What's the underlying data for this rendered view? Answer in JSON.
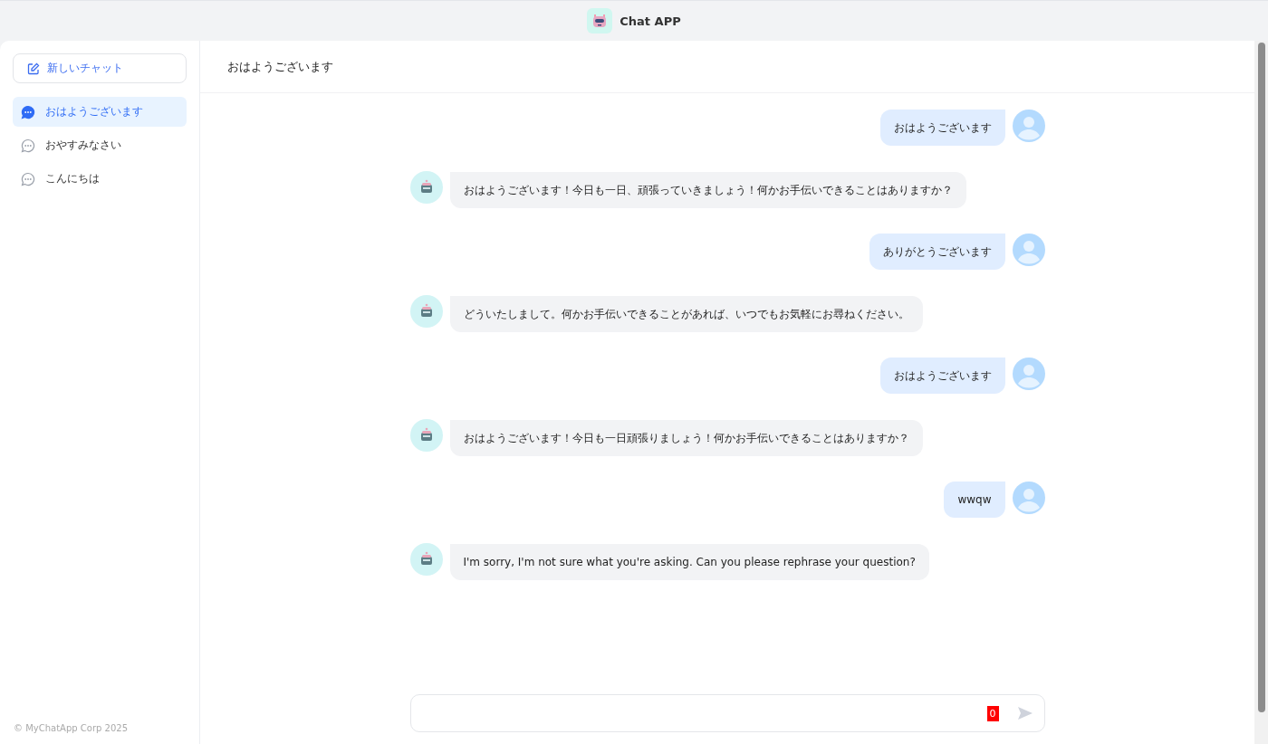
{
  "header": {
    "title": "Chat APP"
  },
  "sidebar": {
    "new_chat": "新しいチャット",
    "items": [
      {
        "label": "おはようございます",
        "selected": true
      },
      {
        "label": "おやすみなさい",
        "selected": false
      },
      {
        "label": "こんにちは",
        "selected": false
      }
    ],
    "footer": "© MyChatApp Corp 2025"
  },
  "chat": {
    "title": "おはようございます",
    "messages": [
      {
        "kind": "user",
        "text": "おはようございます"
      },
      {
        "kind": "bot",
        "text": "おはようございます！今日も一日、頑張っていきましょう！何かお手伝いできることはありますか？"
      },
      {
        "kind": "user",
        "text": "ありがとうございます"
      },
      {
        "kind": "bot",
        "text": "どういたしまして。何かお手伝いできることがあれば、いつでもお気軽にお尋ねください。"
      },
      {
        "kind": "user",
        "text": "おはようございます"
      },
      {
        "kind": "bot",
        "text": "おはようございます！今日も一日頑張りましょう！何かお手伝いできることはありますか？"
      },
      {
        "kind": "user",
        "text": "wwqw"
      },
      {
        "kind": "bot",
        "text": "I'm sorry, I'm not sure what you're asking. Can you please rephrase your question?"
      }
    ],
    "input": {
      "counter": "0"
    }
  }
}
